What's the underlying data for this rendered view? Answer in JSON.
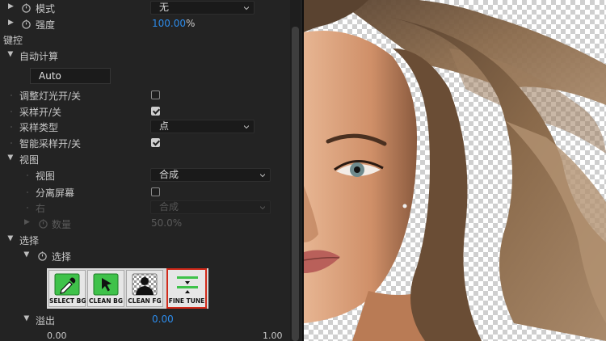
{
  "rows": {
    "mode": {
      "label": "模式",
      "value": "无"
    },
    "strength": {
      "label": "强度",
      "value": "100.00",
      "unit": "%"
    },
    "keying": {
      "label": "键控"
    },
    "auto_calc": {
      "label": "自动计算",
      "value": "Auto"
    },
    "adjust_light": {
      "label": "调整灯光开/关",
      "checked": false
    },
    "sample_toggle": {
      "label": "采样开/关",
      "checked": true
    },
    "sample_type": {
      "label": "采样类型",
      "value": "点"
    },
    "smart_sample": {
      "label": "智能采样开/关",
      "checked": true
    },
    "view": {
      "label": "视图"
    },
    "view_select": {
      "label": "视图",
      "value": "合成"
    },
    "split_screen": {
      "label": "分离屏幕",
      "checked": false
    },
    "right": {
      "label": "右",
      "value": "合成"
    },
    "count": {
      "label": "数量",
      "value": "50.0",
      "unit": "%"
    },
    "selection": {
      "label": "选择"
    },
    "selection_sub": {
      "label": "选择"
    },
    "spill": {
      "label": "溢出",
      "value": "0.00",
      "slider_min": "0.00",
      "slider_max": "1.00"
    }
  },
  "tool_buttons": [
    {
      "label": "SELECT BG",
      "icon": "eyedropper-icon",
      "selected": false
    },
    {
      "label": "CLEAN BG",
      "icon": "cursor-arrow-icon",
      "selected": false
    },
    {
      "label": "CLEAN FG",
      "icon": "person-silhouette-icon",
      "selected": false
    },
    {
      "label": "FINE TUNE",
      "icon": "fine-tune-sliders-icon",
      "selected": true
    }
  ],
  "colors": {
    "accent_blue": "#2d8ceb",
    "selected_border": "#d22a1a",
    "button_green": "#3fc24a"
  }
}
